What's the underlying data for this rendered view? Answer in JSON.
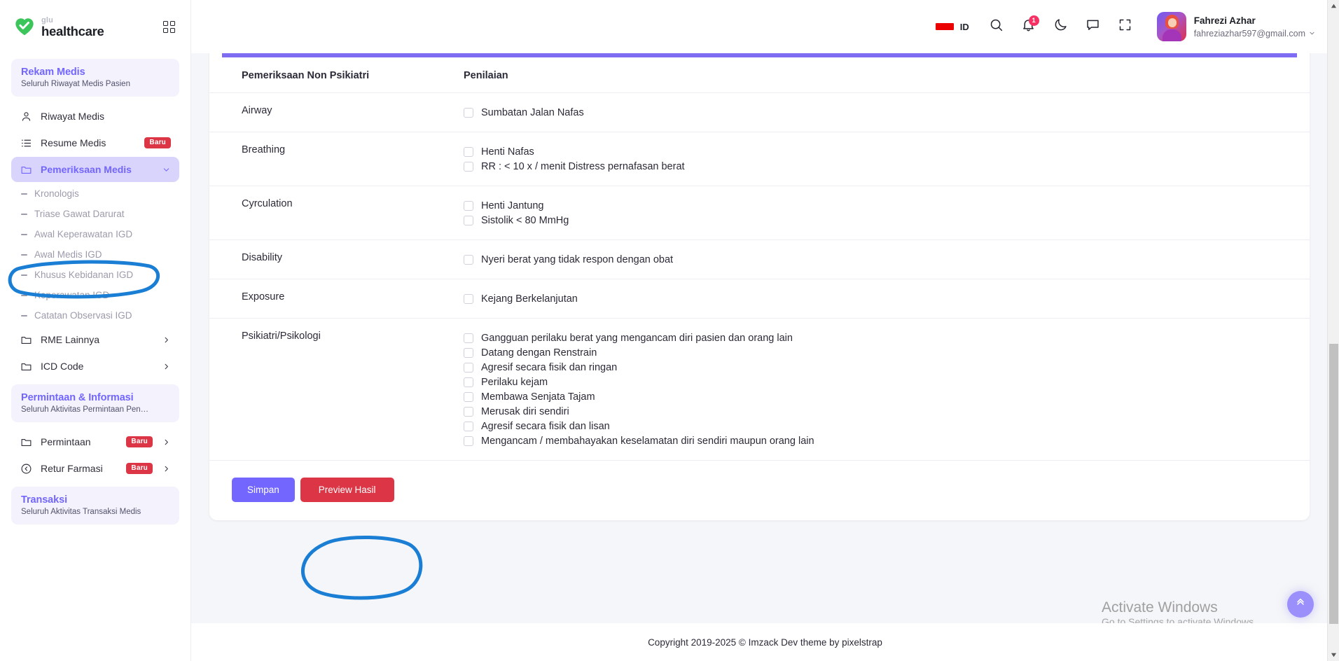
{
  "brand": {
    "sub": "glu",
    "name": "healthcare",
    "accent": "#7366ff",
    "danger": "#dc3545"
  },
  "header": {
    "language": "ID",
    "notification_count": "1",
    "user_name": "Fahrezi Azhar",
    "user_email": "fahreziazhar597@gmail.com"
  },
  "sidebar": {
    "sections": [
      {
        "title": "Rekam Medis",
        "subtitle": "Seluruh Riwayat Medis Pasien"
      },
      {
        "title": "Permintaan & Informasi",
        "subtitle": "Seluruh Aktivitas Permintaan Pen…"
      },
      {
        "title": "Transaksi",
        "subtitle": "Seluruh Aktivitas Transaksi Medis"
      }
    ],
    "items": [
      {
        "label": "Riwayat Medis",
        "icon": "user-icon"
      },
      {
        "label": "Resume Medis",
        "icon": "list-icon",
        "badge": "Baru"
      },
      {
        "label": "Pemeriksaan Medis",
        "icon": "folder-icon",
        "active": true
      },
      {
        "label": "RME Lainnya",
        "icon": "folder-icon"
      },
      {
        "label": "ICD Code",
        "icon": "folder-icon"
      },
      {
        "label": "Permintaan",
        "icon": "folder-icon",
        "badge": "Baru"
      },
      {
        "label": "Retur Farmasi",
        "icon": "arrow-left-circle-icon",
        "badge": "Baru"
      }
    ],
    "submenu": [
      "Kronologis",
      "Triase Gawat Darurat",
      "Awal Keperawatan IGD",
      "Awal Medis IGD",
      "Khusus Kebidanan IGD",
      "Keperawatan IGD",
      "Catatan Observasi IGD"
    ]
  },
  "main": {
    "table": {
      "headers": [
        "Pemeriksaan Non Psikiatri",
        "Penilaian"
      ],
      "rows": [
        {
          "category": "Airway",
          "options": [
            "Sumbatan Jalan Nafas"
          ]
        },
        {
          "category": "Breathing",
          "options": [
            "Henti Nafas",
            "RR : < 10 x / menit Distress pernafasan berat"
          ]
        },
        {
          "category": "Cyrculation",
          "options": [
            "Henti Jantung",
            "Sistolik < 80 MmHg"
          ]
        },
        {
          "category": "Disability",
          "options": [
            "Nyeri berat yang tidak respon dengan obat"
          ]
        },
        {
          "category": "Exposure",
          "options": [
            "Kejang Berkelanjutan"
          ]
        },
        {
          "category": "Psikiatri/Psikologi",
          "options": [
            "Gangguan perilaku berat yang mengancam diri pasien dan orang lain",
            "Datang dengan Renstrain",
            "Agresif secara fisik dan ringan",
            "Perilaku kejam",
            "Membawa Senjata Tajam",
            "Merusak diri sendiri",
            "Agresif secara fisik dan lisan",
            "Mengancam / membahayakan keselamatan diri sendiri maupun orang lain"
          ]
        }
      ]
    },
    "buttons": {
      "save": "Simpan",
      "preview": "Preview Hasil"
    }
  },
  "footer": {
    "copyright": "Copyright 2019-2025 © Imzack Dev theme by pixelstrap"
  },
  "watermark": {
    "line1": "Activate Windows",
    "line2": "Go to Settings to activate Windows."
  }
}
